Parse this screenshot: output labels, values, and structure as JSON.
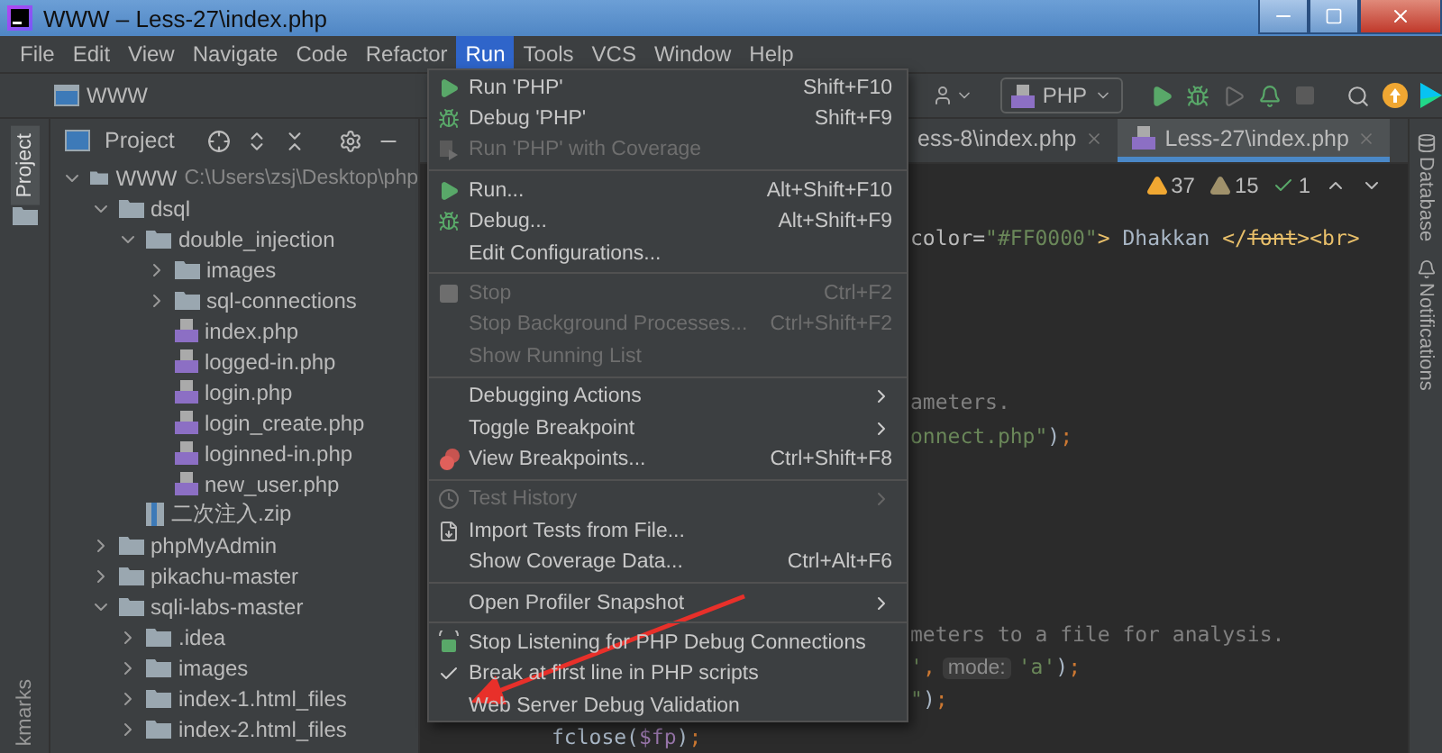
{
  "window": {
    "title": "WWW – Less-27\\index.php"
  },
  "menu_bar": [
    {
      "label": "File",
      "selected": false
    },
    {
      "label": "Edit",
      "selected": false
    },
    {
      "label": "View",
      "selected": false
    },
    {
      "label": "Navigate",
      "selected": false
    },
    {
      "label": "Code",
      "selected": false
    },
    {
      "label": "Refactor",
      "selected": false
    },
    {
      "label": "Run",
      "selected": true
    },
    {
      "label": "Tools",
      "selected": false
    },
    {
      "label": "VCS",
      "selected": false
    },
    {
      "label": "Window",
      "selected": false
    },
    {
      "label": "Help",
      "selected": false
    }
  ],
  "breadcrumb": "WWW",
  "run_configuration": "PHP",
  "left_strip": [
    {
      "label": "Project",
      "selected": true
    },
    {
      "label": "kmarks",
      "selected": false
    }
  ],
  "project_panel": {
    "title": "Project",
    "tree": [
      {
        "name": "WWW",
        "kind": "folder",
        "path": "C:\\Users\\zsj\\Desktop\\php",
        "expanded": true,
        "children": [
          {
            "name": "dsql",
            "kind": "folder",
            "expanded": true,
            "children": [
              {
                "name": "double_injection",
                "kind": "folder",
                "expanded": true,
                "children": [
                  {
                    "name": "images",
                    "kind": "folder",
                    "expanded": false
                  },
                  {
                    "name": "sql-connections",
                    "kind": "folder",
                    "expanded": false
                  },
                  {
                    "name": "index.php",
                    "kind": "php"
                  },
                  {
                    "name": "logged-in.php",
                    "kind": "php"
                  },
                  {
                    "name": "login.php",
                    "kind": "php"
                  },
                  {
                    "name": "login_create.php",
                    "kind": "php"
                  },
                  {
                    "name": "loginned-in.php",
                    "kind": "php"
                  },
                  {
                    "name": "new_user.php",
                    "kind": "php"
                  }
                ]
              },
              {
                "name": "二次注入.zip",
                "kind": "zip"
              }
            ]
          },
          {
            "name": "phpMyAdmin",
            "kind": "folder",
            "expanded": false
          },
          {
            "name": "pikachu-master",
            "kind": "folder",
            "expanded": false
          },
          {
            "name": "sqli-labs-master",
            "kind": "folder",
            "expanded": true,
            "children": [
              {
                "name": ".idea",
                "kind": "folder",
                "expanded": false
              },
              {
                "name": "images",
                "kind": "folder",
                "expanded": false
              },
              {
                "name": "index-1.html_files",
                "kind": "folder",
                "expanded": false
              },
              {
                "name": "index-2.html_files",
                "kind": "folder",
                "expanded": false
              }
            ]
          }
        ]
      }
    ]
  },
  "editor_tabs": [
    {
      "label": "ess-8\\index.php",
      "selected": false
    },
    {
      "label": "Less-27\\index.php",
      "selected": true
    }
  ],
  "inspections": [
    {
      "kind": "warning",
      "count": "37"
    },
    {
      "kind": "weak-warning",
      "count": "15"
    },
    {
      "kind": "typo",
      "count": "1"
    }
  ],
  "code_lines": [
    {
      "kind": "clipped",
      "tokens": [
        {
          "kind": "attr",
          "text": "color="
        },
        {
          "kind": "string",
          "text": "\"#FF0000\""
        },
        {
          "kind": "tag",
          "text": ">"
        },
        {
          "kind": "text",
          "text": " Dhakkan "
        },
        {
          "kind": "tag",
          "text": "</"
        },
        {
          "kind": "deprecated",
          "text": "font"
        },
        {
          "kind": "tag",
          "text": "><br>"
        }
      ]
    },
    {
      "kind": "covered"
    },
    {
      "kind": "covered"
    },
    {
      "kind": "covered"
    },
    {
      "kind": "covered"
    },
    {
      "kind": "clipped",
      "tokens": [
        {
          "kind": "comment",
          "text": "ameters."
        }
      ]
    },
    {
      "kind": "clipped",
      "tokens": [
        {
          "kind": "string",
          "text": "onnect.php\""
        },
        {
          "kind": "text",
          "text": ")"
        },
        {
          "kind": "keyword",
          "text": ";"
        }
      ]
    },
    {
      "kind": "covered"
    },
    {
      "kind": "covered"
    },
    {
      "kind": "covered"
    },
    {
      "kind": "covered"
    },
    {
      "kind": "covered"
    },
    {
      "kind": "clipped",
      "tokens": [
        {
          "kind": "comment",
          "text": "meters to a file for analysis."
        }
      ]
    },
    {
      "kind": "clipped",
      "tokens": [
        {
          "kind": "string",
          "text": "'"
        },
        {
          "kind": "keyword",
          "text": ","
        },
        {
          "kind": "hint",
          "text": "mode:"
        },
        {
          "kind": "string",
          "text": "'a'"
        },
        {
          "kind": "text",
          "text": ")"
        },
        {
          "kind": "keyword",
          "text": ";"
        }
      ]
    },
    {
      "kind": "clipped",
      "tokens": [
        {
          "kind": "string",
          "text": "\""
        },
        {
          "kind": "text",
          "text": ")"
        },
        {
          "kind": "keyword",
          "text": ";"
        }
      ]
    },
    {
      "kind": "indented",
      "tokens": [
        {
          "kind": "text",
          "text": "fclose("
        },
        {
          "kind": "variable",
          "text": "$fp"
        },
        {
          "kind": "text",
          "text": ")"
        },
        {
          "kind": "keyword",
          "text": ";"
        }
      ]
    }
  ],
  "right_strip": [
    {
      "label": "Database"
    },
    {
      "label": "Notifications"
    }
  ],
  "run_menu": [
    {
      "kind": "item",
      "label": "Run 'PHP'",
      "shortcut": "Shift+F10",
      "disabled": false,
      "submenu": false,
      "checked": false
    },
    {
      "kind": "item",
      "label": "Debug 'PHP'",
      "shortcut": "Shift+F9",
      "disabled": false,
      "submenu": false,
      "checked": false
    },
    {
      "kind": "item",
      "label": "Run 'PHP' with Coverage",
      "disabled": true,
      "submenu": false,
      "checked": false
    },
    {
      "kind": "separator"
    },
    {
      "kind": "item",
      "label": "Run...",
      "shortcut": "Alt+Shift+F10",
      "disabled": false,
      "submenu": false,
      "checked": false
    },
    {
      "kind": "item",
      "label": "Debug...",
      "shortcut": "Alt+Shift+F9",
      "disabled": false,
      "submenu": false,
      "checked": false
    },
    {
      "kind": "item",
      "label": "Edit Configurations...",
      "disabled": false,
      "submenu": false,
      "checked": false
    },
    {
      "kind": "separator"
    },
    {
      "kind": "item",
      "label": "Stop",
      "shortcut": "Ctrl+F2",
      "disabled": true,
      "submenu": false,
      "checked": false
    },
    {
      "kind": "item",
      "label": "Stop Background Processes...",
      "shortcut": "Ctrl+Shift+F2",
      "disabled": true,
      "submenu": false,
      "checked": false
    },
    {
      "kind": "item",
      "label": "Show Running List",
      "disabled": true,
      "submenu": false,
      "checked": false
    },
    {
      "kind": "separator"
    },
    {
      "kind": "item",
      "label": "Debugging Actions",
      "disabled": false,
      "submenu": true,
      "checked": false
    },
    {
      "kind": "item",
      "label": "Toggle Breakpoint",
      "disabled": false,
      "submenu": true,
      "checked": false
    },
    {
      "kind": "item",
      "label": "View Breakpoints...",
      "shortcut": "Ctrl+Shift+F8",
      "disabled": false,
      "submenu": false,
      "checked": false
    },
    {
      "kind": "separator"
    },
    {
      "kind": "item",
      "label": "Test History",
      "disabled": true,
      "submenu": true,
      "checked": false
    },
    {
      "kind": "item",
      "label": "Import Tests from File...",
      "disabled": false,
      "submenu": false,
      "checked": false
    },
    {
      "kind": "item",
      "label": "Show Coverage Data...",
      "shortcut": "Ctrl+Alt+F6",
      "disabled": false,
      "submenu": false,
      "checked": false
    },
    {
      "kind": "separator"
    },
    {
      "kind": "item",
      "label": "Open Profiler Snapshot",
      "disabled": false,
      "submenu": true,
      "checked": false
    },
    {
      "kind": "separator"
    },
    {
      "kind": "item",
      "label": "Stop Listening for PHP Debug Connections",
      "disabled": false,
      "submenu": false,
      "checked": false
    },
    {
      "kind": "item",
      "label": "Break at first line in PHP scripts",
      "disabled": false,
      "submenu": false,
      "checked": true
    },
    {
      "kind": "item",
      "label": "Web Server Debug Validation",
      "disabled": false,
      "submenu": false,
      "checked": false
    }
  ]
}
